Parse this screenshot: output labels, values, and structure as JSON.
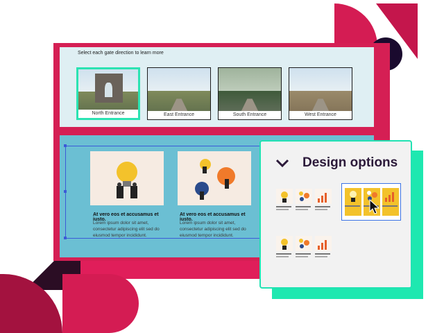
{
  "gates": {
    "title": "Select each gate direction to learn more",
    "items": [
      {
        "label": "North Entrance",
        "selected": true
      },
      {
        "label": "East Entrance",
        "selected": false
      },
      {
        "label": "South Entrance",
        "selected": false
      },
      {
        "label": "West Entrance",
        "selected": false
      }
    ]
  },
  "cards": [
    {
      "title": "At vero eos et accusamus et iusto.",
      "body": "Lorem ipsum dolor sit amet, consectetur adipiscing elit sed do eiusmod tempor incididunt."
    },
    {
      "title": "At vero eos et accusamus et iusto.",
      "body": "Lorem ipsum dolor sit amet, consectetur adipiscing elit sed do eiusmod tempor incididunt."
    }
  ],
  "design_panel": {
    "title": "Design options",
    "icon": "chevron-down-icon",
    "selected_option": 2
  },
  "colors": {
    "brand_red": "#d51f54",
    "accent_teal": "#21e2b3",
    "card_band": "#6bbfd3",
    "selection_blue": "#3b73e6"
  }
}
